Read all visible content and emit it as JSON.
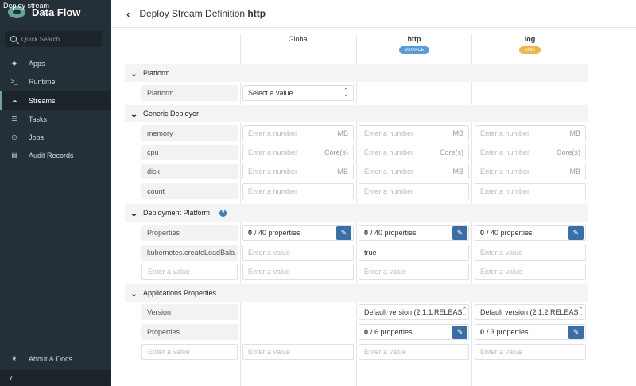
{
  "window": {
    "title": "Deploy stream"
  },
  "sidebar": {
    "logo_text": "Data Flow",
    "search_placeholder": "Quick Search",
    "items": [
      {
        "label": "Apps",
        "icon": "tags-icon"
      },
      {
        "label": "Runtime",
        "icon": "terminal-icon"
      },
      {
        "label": "Streams",
        "icon": "cloud-icon"
      },
      {
        "label": "Tasks",
        "icon": "list-icon"
      },
      {
        "label": "Jobs",
        "icon": "clock-icon"
      },
      {
        "label": "Audit Records",
        "icon": "audit-icon"
      }
    ],
    "about_label": "About & Docs",
    "collapse_icon": "chevron-left-icon"
  },
  "header": {
    "title_prefix": "Deploy Stream Definition",
    "title_name": "http"
  },
  "columns": {
    "global": {
      "label": "Global"
    },
    "http": {
      "label": "http",
      "badge": "SOURCE",
      "badge_color": "#5b9bd5"
    },
    "log": {
      "label": "log",
      "badge": "SINK",
      "badge_color": "#e8b84a"
    }
  },
  "sections": {
    "platform": {
      "label": "Platform",
      "row_label": "Platform",
      "select_value": "Select a value"
    },
    "generic": {
      "label": "Generic Deployer",
      "rows": [
        {
          "label": "memory",
          "placeholder": "Enter a number",
          "unit": "MB"
        },
        {
          "label": "cpu",
          "placeholder": "Enter a number",
          "unit": "Core(s)"
        },
        {
          "label": "disk",
          "placeholder": "Enter a number",
          "unit": "MB"
        },
        {
          "label": "count",
          "placeholder": "Enter a number",
          "unit": ""
        }
      ]
    },
    "deployment": {
      "label": "Deployment Platform",
      "properties_label": "Properties",
      "global_props": "0",
      "global_props_total": "/ 40 properties",
      "http_props": "0",
      "http_props_total": "/ 40 properties",
      "log_props": "0",
      "log_props_total": "/ 40 properties",
      "load_balancer_label": "kubernetes.createLoadBala",
      "load_balancer_http_value": "true",
      "value_placeholder": "Enter a value"
    },
    "applications": {
      "label": "Applications Properties",
      "version_label": "Version",
      "http_version": "Default version (2.1.1.RELEAS",
      "log_version": "Default version (2.1.2.RELEAS",
      "properties_label": "Properties",
      "http_props": "0",
      "http_props_total": "/ 6 properties",
      "log_props": "0",
      "log_props_total": "/ 3 properties",
      "value_placeholder": "Enter a value"
    }
  }
}
